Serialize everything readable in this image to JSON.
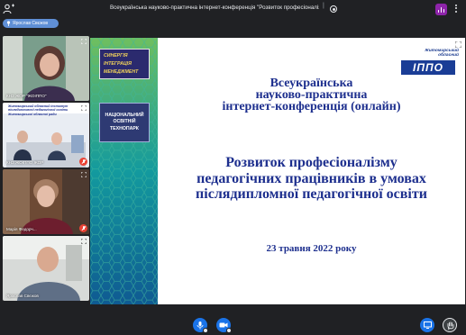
{
  "topbar": {
    "meeting_title": "Всеукраїнська науково-практична інтернет-конференція \"Розвиток професіоналізму пе...",
    "separator": "|"
  },
  "presenter_chip": {
    "label": "Ярослав Свєжов"
  },
  "participants": [
    {
      "name": "КНЗ ЖОР \"ЖОІППО\""
    },
    {
      "name": "КНЗ ЖОІППО ЖОР"
    },
    {
      "name": "Марія Федорч..."
    },
    {
      "name": "Ярослав Свєжов"
    }
  ],
  "participant_slides": {
    "tile2_caption": "Житомирський обласний інститут післядипломної педагогічної освіти Житомирської обласної ради"
  },
  "slide": {
    "left_panel": {
      "bundle": [
        "СИНЕРГІЯ",
        "ІНТЕГРАЦІЯ",
        "МЕНЕДЖМЕНТ"
      ],
      "techpark": [
        "НАЦІОНАЛЬНИЙ",
        "ОСВІТНІЙ",
        "ТЕХНОПАРК"
      ]
    },
    "logo": {
      "region": [
        "Житомирський",
        "обласний"
      ],
      "text": "ІППО"
    },
    "conference": [
      "Всеукраїнська",
      "науково-практична",
      "інтернет-конференція (онлайн)"
    ],
    "topic": [
      "Розвиток професіоналізму",
      "педагогічних працівників в умовах",
      "післядипломної педагогічної освіти"
    ],
    "date": "23 травня 2022 року"
  },
  "colors": {
    "background": "#202124",
    "accent": "#1a73e8",
    "slide_text": "#1d2f8e",
    "panel": "#0f6b8e",
    "muted_mic": "#ea4335",
    "audio_badge": "#8e24aa"
  },
  "icons": [
    "people-icon",
    "record-icon",
    "audio-level-icon",
    "more-options-icon",
    "pin-icon",
    "expand-icon",
    "mic-off-icon",
    "mic-icon",
    "camera-icon",
    "present-screen-icon",
    "raise-hand-icon"
  ]
}
